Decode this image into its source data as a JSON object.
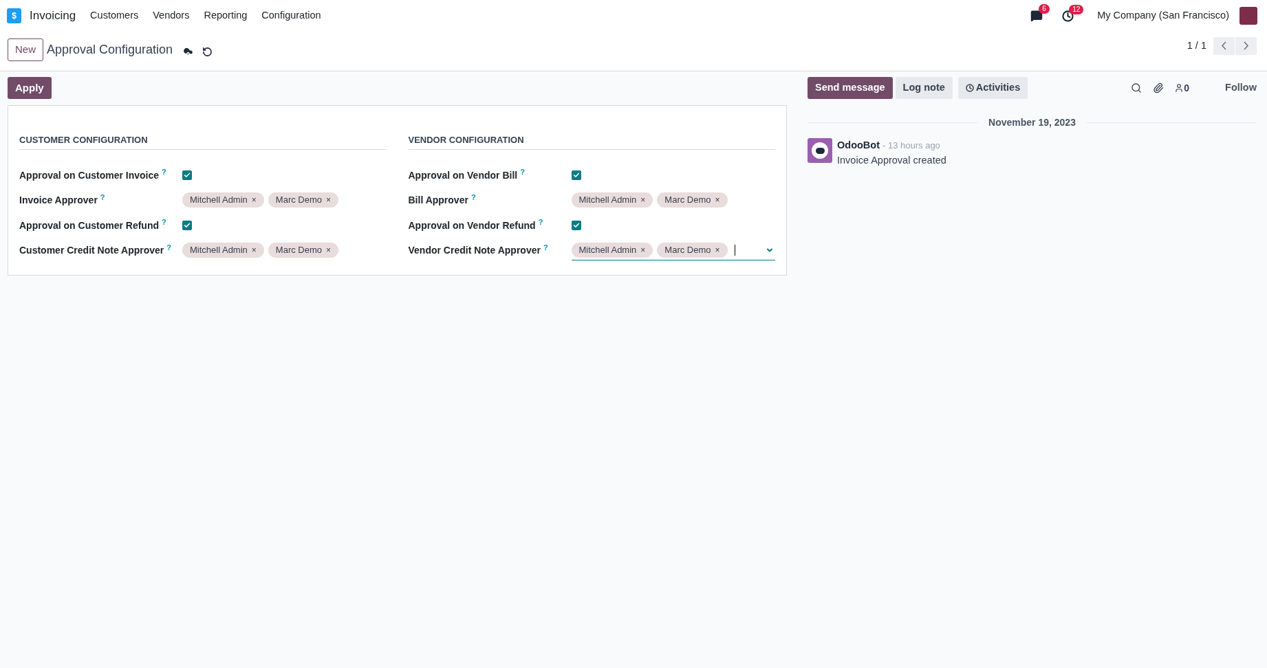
{
  "navbar": {
    "logo_symbol": "$",
    "app": "Invoicing",
    "menu": [
      "Customers",
      "Vendors",
      "Reporting",
      "Configuration"
    ],
    "messages_count": "6",
    "activities_count": "12",
    "company": "My Company (San Francisco)"
  },
  "control_panel": {
    "new_button": "New",
    "title": "Approval Configuration",
    "pager": "1 / 1"
  },
  "form": {
    "apply_button": "Apply",
    "sections": [
      {
        "title": "CUSTOMER CONFIGURATION",
        "fields": [
          {
            "kind": "checkbox",
            "label": "Approval on Customer Invoice",
            "help": "?",
            "checked": true
          },
          {
            "kind": "tags",
            "label": "Invoice Approver",
            "help": "?",
            "tags": [
              {
                "name": "Mitchell Admin",
                "remove": "×"
              },
              {
                "name": "Marc Demo",
                "remove": "×"
              }
            ],
            "focused": false
          },
          {
            "kind": "checkbox",
            "label": "Approval on Customer Refund",
            "help": "?",
            "checked": true
          },
          {
            "kind": "tags",
            "label": "Customer Credit Note Approver",
            "help": "?",
            "tags": [
              {
                "name": "Mitchell Admin",
                "remove": "×"
              },
              {
                "name": "Marc Demo",
                "remove": "×"
              }
            ],
            "focused": false
          }
        ]
      },
      {
        "title": "VENDOR CONFIGURATION",
        "fields": [
          {
            "kind": "checkbox",
            "label": "Approval on Vendor Bill",
            "help": "?",
            "checked": true
          },
          {
            "kind": "tags",
            "label": "Bill Approver",
            "help": "?",
            "tags": [
              {
                "name": "Mitchell Admin",
                "remove": "×"
              },
              {
                "name": "Marc Demo",
                "remove": "×"
              }
            ],
            "focused": false
          },
          {
            "kind": "checkbox",
            "label": "Approval on Vendor Refund",
            "help": "?",
            "checked": true
          },
          {
            "kind": "tags",
            "label": "Vendor Credit Note Approver",
            "help": "?",
            "tags": [
              {
                "name": "Mitchell Admin",
                "remove": "×"
              },
              {
                "name": "Marc Demo",
                "remove": "×"
              }
            ],
            "focused": true
          }
        ]
      }
    ]
  },
  "chatter": {
    "send_message": "Send message",
    "log_note": "Log note",
    "activities": "Activities",
    "followers_count": "0",
    "follow": "Follow",
    "date": "November 19, 2023",
    "messages": [
      {
        "author": "OdooBot",
        "time": "- 13 hours ago",
        "body": "Invoice Approval created"
      }
    ]
  }
}
